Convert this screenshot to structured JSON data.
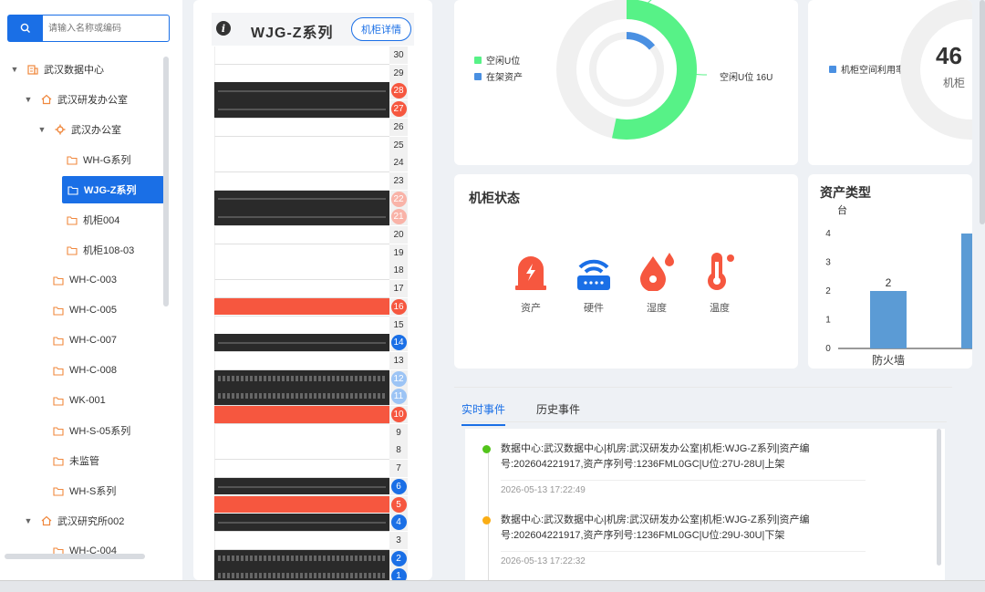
{
  "search": {
    "placeholder": "请输入名称或编码"
  },
  "tree": {
    "items": [
      {
        "label": "武汉数据中心",
        "arrow": "▼",
        "icon": "building-icon"
      },
      {
        "label": "武汉研发办公室",
        "arrow": "▼",
        "icon": "home-icon"
      },
      {
        "label": "武汉办公室",
        "arrow": "▼",
        "icon": "gear-icon"
      },
      {
        "label": "WH-G系列",
        "icon": "folder-icon"
      },
      {
        "label": "WJG-Z系列",
        "icon": "folder-icon",
        "selected": true
      },
      {
        "label": "机柜004",
        "icon": "folder-icon"
      },
      {
        "label": "机柜108-03",
        "icon": "folder-icon"
      },
      {
        "label": "WH-C-003",
        "icon": "folder-icon"
      },
      {
        "label": "WH-C-005",
        "icon": "folder-icon"
      },
      {
        "label": "WH-C-007",
        "icon": "folder-icon"
      },
      {
        "label": "WH-C-008",
        "icon": "folder-icon"
      },
      {
        "label": "WK-001",
        "icon": "folder-icon"
      },
      {
        "label": "WH-S-05系列",
        "icon": "folder-icon"
      },
      {
        "label": "未监管",
        "icon": "folder-icon"
      },
      {
        "label": "WH-S系列",
        "icon": "folder-icon"
      },
      {
        "label": "武汉研究所002",
        "arrow": "▼",
        "icon": "home-icon"
      },
      {
        "label": "WH-C-004",
        "icon": "folder-icon"
      }
    ]
  },
  "rack": {
    "title": "WJG-Z系列",
    "detail_label": "机柜详情",
    "units": [
      {
        "u": "30"
      },
      {
        "u": "29"
      },
      {
        "u": "28",
        "state": "red"
      },
      {
        "u": "27",
        "state": "red"
      },
      {
        "u": "26"
      },
      {
        "u": "25"
      },
      {
        "u": "24"
      },
      {
        "u": "23"
      },
      {
        "u": "22",
        "state": "lightred"
      },
      {
        "u": "21",
        "state": "lightred"
      },
      {
        "u": "20"
      },
      {
        "u": "19"
      },
      {
        "u": "18"
      },
      {
        "u": "17"
      },
      {
        "u": "16",
        "state": "red"
      },
      {
        "u": "15"
      },
      {
        "u": "14",
        "state": "blue"
      },
      {
        "u": "13"
      },
      {
        "u": "12",
        "state": "lightblue"
      },
      {
        "u": "11",
        "state": "lightblue"
      },
      {
        "u": "10",
        "state": "red"
      },
      {
        "u": "9"
      },
      {
        "u": "8"
      },
      {
        "u": "7"
      },
      {
        "u": "6",
        "state": "blue"
      },
      {
        "u": "5",
        "state": "red"
      },
      {
        "u": "4",
        "state": "blue"
      },
      {
        "u": "3"
      },
      {
        "u": "2",
        "state": "blue"
      },
      {
        "u": "1",
        "state": "blue"
      }
    ]
  },
  "u_chart": {
    "legend": [
      {
        "label": "空闲U位",
        "color": "#57f287"
      },
      {
        "label": "在架资产",
        "color": "#4a90e2"
      }
    ],
    "callout": "空闲U位 16U",
    "values": {
      "free": 16,
      "used": 14
    }
  },
  "util_chart": {
    "legend_label": "机柜空间利用率",
    "legend_color": "#4a90e2",
    "value_text": "46",
    "sub_text": "机柜"
  },
  "cabinet_status": {
    "title": "机柜状态",
    "items": [
      {
        "label": "资产",
        "icon": "alarm-icon",
        "color": "#f6573f"
      },
      {
        "label": "硬件",
        "icon": "router-icon",
        "color": "#1a6fe6"
      },
      {
        "label": "湿度",
        "icon": "humidity-icon",
        "color": "#f6573f"
      },
      {
        "label": "温度",
        "icon": "thermometer-icon",
        "color": "#f6573f"
      }
    ]
  },
  "chart_data": {
    "type": "bar",
    "title": "资产类型",
    "ylabel": "台",
    "categories": [
      "防火墙",
      ""
    ],
    "values": [
      2,
      4
    ],
    "ylim": [
      0,
      4
    ],
    "yticks": [
      "0",
      "1",
      "2",
      "3",
      "4"
    ],
    "data_labels": [
      "2"
    ],
    "color": "#5b9bd5"
  },
  "events": {
    "tabs": [
      "实时事件",
      "历史事件"
    ],
    "items": [
      {
        "text": "数据中心:武汉数据中心|机房:武汉研发办公室|机柜:WJG-Z系列|资产编号:202604221917,资产序列号:1236FML0GC|U位:27U-28U|上架",
        "time": "2026-05-13 17:22:49",
        "color": "#52c41a"
      },
      {
        "text": "数据中心:武汉数据中心|机房:武汉研发办公室|机柜:WJG-Z系列|资产编号:202604221917,资产序列号:1236FML0GC|U位:29U-30U|下架",
        "time": "2026-05-13 17:22:32",
        "color": "#faad14"
      }
    ]
  }
}
